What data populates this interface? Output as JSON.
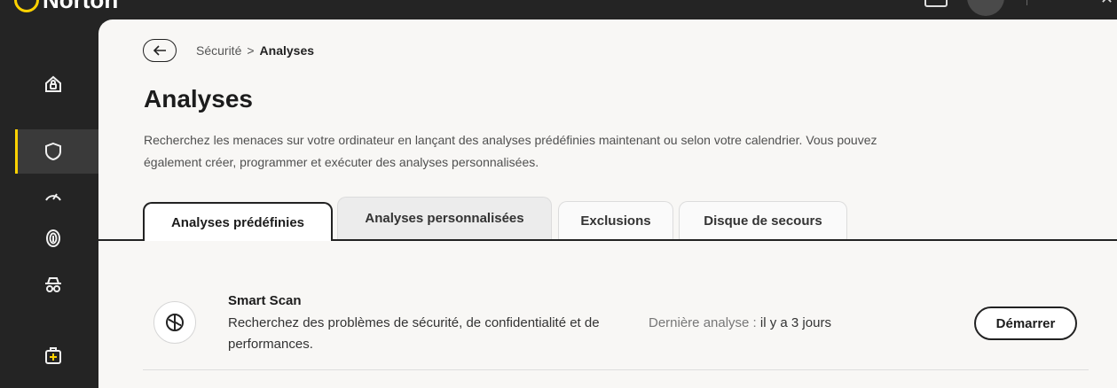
{
  "app": {
    "name": "Norton"
  },
  "breadcrumb": {
    "parent": "Sécurité",
    "separator": ">",
    "current": "Analyses"
  },
  "page": {
    "title": "Analyses",
    "description": "Recherchez les menaces sur votre ordinateur en lançant des analyses prédéfinies maintenant ou selon votre calendrier. Vous pouvez également créer, programmer et exécuter des analyses personnalisées."
  },
  "tabs": [
    {
      "label": "Analyses prédéfinies",
      "active": true
    },
    {
      "label": "Analyses personnalisées",
      "active": false
    },
    {
      "label": "Exclusions",
      "active": false
    },
    {
      "label": "Disque de secours",
      "active": false
    }
  ],
  "scans": [
    {
      "title": "Smart Scan",
      "description": "Recherchez des problèmes de sécurité, de confidentialité et de performances.",
      "last_scan_label": "Dernière analyse :",
      "last_scan_value": "il y a 3 jours",
      "button": "Démarrer"
    }
  ],
  "colors": {
    "accent": "#ffd200",
    "sidebar": "#242424",
    "panel": "#f8f7f5"
  },
  "sidebar_icons": [
    "home-lock-icon",
    "shield-icon",
    "speed-icon",
    "fingerprint-icon",
    "incognito-icon",
    "toolbox-plus-icon"
  ]
}
